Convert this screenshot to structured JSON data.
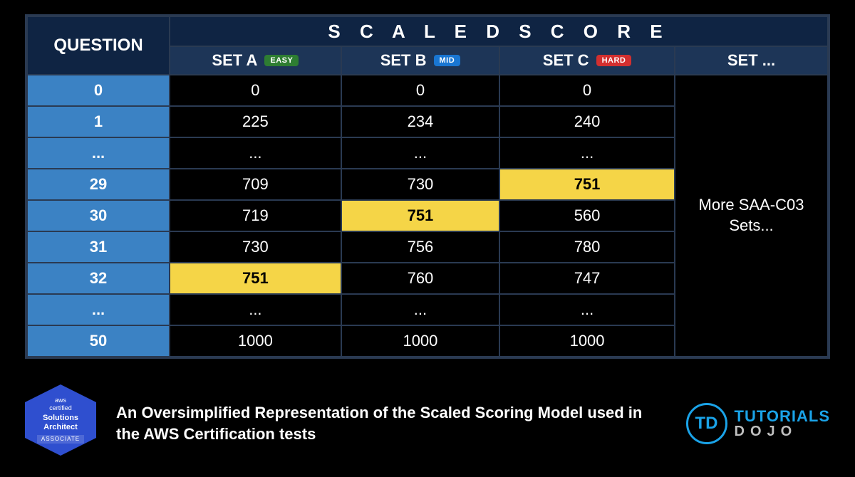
{
  "table": {
    "question_header": "QUESTION",
    "scaled_header": "S C A L E D    S C O R E",
    "sets": [
      {
        "label": "SET A",
        "difficulty": "EASY",
        "difficulty_class": "badge-easy"
      },
      {
        "label": "SET B",
        "difficulty": "MID",
        "difficulty_class": "badge-mid"
      },
      {
        "label": "SET C",
        "difficulty": "HARD",
        "difficulty_class": "badge-hard"
      }
    ],
    "more_sets_header": "SET ...",
    "more_sets_text": "More SAA-C03 Sets...",
    "rows": [
      {
        "q": "0",
        "a": "0",
        "b": "0",
        "c": "0",
        "hl": ""
      },
      {
        "q": "1",
        "a": "225",
        "b": "234",
        "c": "240",
        "hl": ""
      },
      {
        "q": "...",
        "a": "...",
        "b": "...",
        "c": "...",
        "hl": ""
      },
      {
        "q": "29",
        "a": "709",
        "b": "730",
        "c": "751",
        "hl": "c"
      },
      {
        "q": "30",
        "a": "719",
        "b": "751",
        "c": "560",
        "hl": "b"
      },
      {
        "q": "31",
        "a": "730",
        "b": "756",
        "c": "780",
        "hl": ""
      },
      {
        "q": "32",
        "a": "751",
        "b": "760",
        "c": "747",
        "hl": "a"
      },
      {
        "q": "...",
        "a": "...",
        "b": "...",
        "c": "...",
        "hl": ""
      },
      {
        "q": "50",
        "a": "1000",
        "b": "1000",
        "c": "1000",
        "hl": ""
      }
    ]
  },
  "footer": {
    "badge": {
      "line1": "aws",
      "line2": "certified",
      "line3": "Solutions",
      "line4": "Architect",
      "line5": "ASSOCIATE"
    },
    "caption": "An Oversimplified Representation of the Scaled Scoring Model used in the AWS Certification tests",
    "logo": {
      "circle": "TD",
      "line1": "TUTORIALS",
      "line2": "DOJO"
    }
  }
}
